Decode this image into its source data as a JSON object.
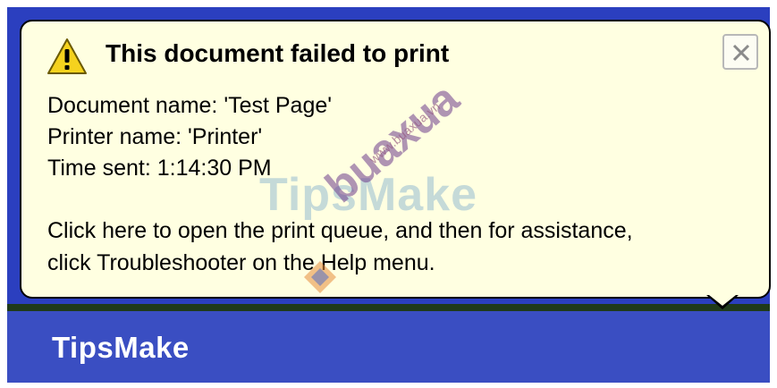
{
  "balloon": {
    "title": "This document failed to print",
    "lines": [
      "Document name: 'Test Page'",
      "Printer name: 'Printer'",
      "Time sent: 1:14:30 PM"
    ],
    "instructions": [
      "Click here to open the print queue, and then for assistance,",
      "click Troubleshooter on the Help menu."
    ],
    "icons": {
      "warning": "warning-icon",
      "close": "close-icon"
    }
  },
  "footer": {
    "brand": "TipsMake"
  },
  "watermark": {
    "text": "TipsMake",
    "logo_text": "buaxua",
    "url": "www.buaxua.vn"
  },
  "colors": {
    "balloon_bg": "#ffffe1",
    "frame_blue": "#2b3fbf",
    "warning_yellow": "#f5d21e"
  }
}
